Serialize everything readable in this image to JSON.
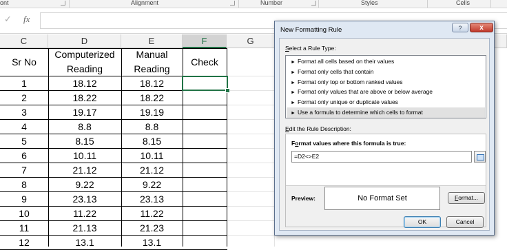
{
  "ribbon": {
    "groups": [
      "ont",
      "Alignment",
      "Number",
      "Styles",
      "Cells"
    ]
  },
  "formula_bar": {
    "cancel_glyph": "✓",
    "fx_label": "fx",
    "value": ""
  },
  "columns": [
    "C",
    "D",
    "E",
    "F",
    "G"
  ],
  "table": {
    "headers": {
      "sr_no": "Sr No",
      "computerized_1": "Computerized",
      "computerized_2": "Reading",
      "manual_1": "Manual",
      "manual_2": "Reading",
      "check": "Check"
    },
    "rows": [
      [
        "1",
        "18.12",
        "18.12"
      ],
      [
        "2",
        "18.22",
        "18.22"
      ],
      [
        "3",
        "19.17",
        "19.19"
      ],
      [
        "4",
        "8.8",
        "8.8"
      ],
      [
        "5",
        "8.15",
        "8.15"
      ],
      [
        "6",
        "10.11",
        "10.11"
      ],
      [
        "7",
        "21.12",
        "21.12"
      ],
      [
        "8",
        "9.22",
        "9.22"
      ],
      [
        "9",
        "23.13",
        "23.13"
      ],
      [
        "10",
        "11.22",
        "11.22"
      ],
      [
        "11",
        "21.13",
        "21.23"
      ],
      [
        "12",
        "13.1",
        "13.1"
      ]
    ]
  },
  "dialog": {
    "title": "New Formatting Rule",
    "help_label": "?",
    "close_label": "x",
    "select_rule_label_u": "S",
    "select_rule_label_rest": "elect a Rule Type:",
    "rule_types": [
      "Format all cells based on their values",
      "Format only cells that contain",
      "Format only top or bottom ranked values",
      "Format only values that are above or below average",
      "Format only unique or duplicate values",
      "Use a formula to determine which cells to format"
    ],
    "selected_rule_index": 5,
    "edit_label_u": "E",
    "edit_label_rest": "dit the Rule Description:",
    "formula_label_pre": "F",
    "formula_label_u": "o",
    "formula_label_rest": "rmat values where this formula is true:",
    "formula_value": "=D2<>E2",
    "preview_label": "Preview:",
    "preview_text": "No Format Set",
    "format_button_u": "F",
    "format_button_rest": "ormat...",
    "ok_label": "OK",
    "cancel_label": "Cancel"
  },
  "colors": {
    "excel_green": "#217346",
    "dialog_bg": "#dfe8f3"
  }
}
